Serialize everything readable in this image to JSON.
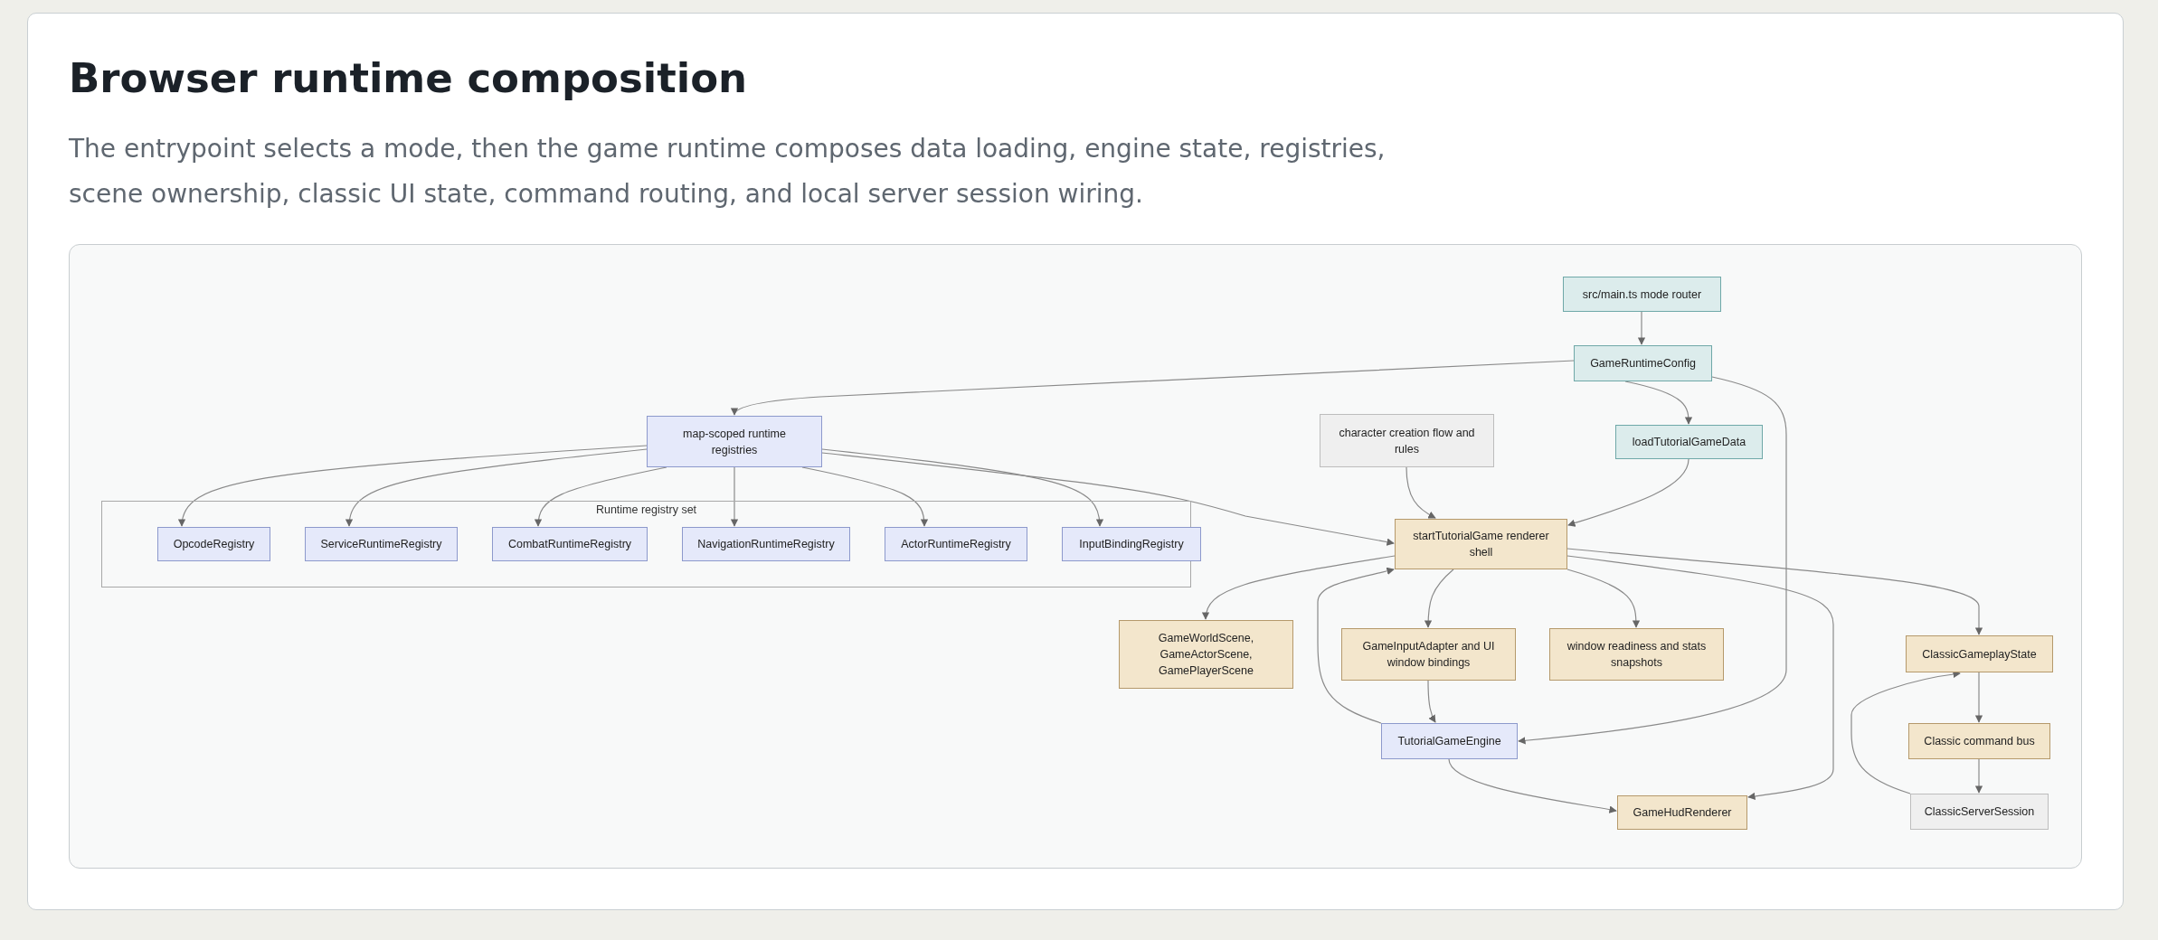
{
  "title": "Browser runtime composition",
  "description": "The entrypoint selects a mode, then the game runtime composes data loading, engine state, registries, scene ownership, classic UI state, command routing, and local server session wiring.",
  "diagram": {
    "nodes": [
      {
        "label": "src/main.ts mode router",
        "kind": "config"
      },
      {
        "label": "GameRuntimeConfig",
        "kind": "config"
      },
      {
        "label": "map-scoped runtime registries",
        "kind": "core"
      },
      {
        "label": "character creation flow and rules",
        "kind": "external"
      },
      {
        "label": "loadTutorialGameData",
        "kind": "config"
      },
      {
        "label": "startTutorialGame renderer shell",
        "kind": "render"
      },
      {
        "label": "GameWorldScene, GameActorScene, GamePlayerScene",
        "kind": "render"
      },
      {
        "label": "GameInputAdapter and UI window bindings",
        "kind": "render"
      },
      {
        "label": "window readiness and stats snapshots",
        "kind": "render"
      },
      {
        "label": "ClassicGameplayState",
        "kind": "render"
      },
      {
        "label": "TutorialGameEngine",
        "kind": "core"
      },
      {
        "label": "Classic command bus",
        "kind": "render"
      },
      {
        "label": "GameHudRenderer",
        "kind": "render"
      },
      {
        "label": "ClassicServerSession",
        "kind": "external"
      }
    ],
    "group": {
      "label": "Runtime registry set",
      "nodes": [
        {
          "label": "OpcodeRegistry",
          "kind": "core"
        },
        {
          "label": "ServiceRuntimeRegistry",
          "kind": "core"
        },
        {
          "label": "CombatRuntimeRegistry",
          "kind": "core"
        },
        {
          "label": "NavigationRuntimeRegistry",
          "kind": "core"
        },
        {
          "label": "ActorRuntimeRegistry",
          "kind": "core"
        },
        {
          "label": "InputBindingRegistry",
          "kind": "core"
        }
      ]
    }
  }
}
